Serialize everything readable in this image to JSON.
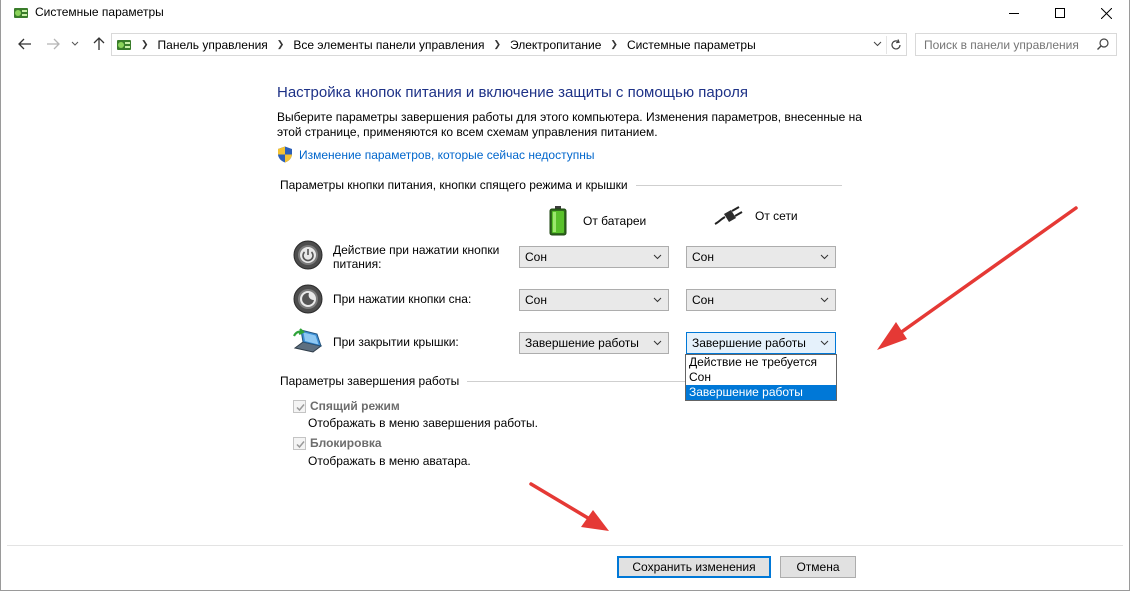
{
  "window": {
    "title": "Системные параметры"
  },
  "address_bar": {
    "breadcrumbs": [
      "Панель управления",
      "Все элементы панели управления",
      "Электропитание",
      "Системные параметры"
    ]
  },
  "search": {
    "placeholder": "Поиск в панели управления"
  },
  "page": {
    "title": "Настройка кнопок питания и включение защиты с помощью пароля",
    "description": "Выберите параметры завершения работы для этого компьютера. Изменения параметров, внесенные на этой странице, применяются ко всем схемам управления питанием.",
    "admin_link": "Изменение параметров, которые сейчас недоступны"
  },
  "power_group": {
    "header": "Параметры кнопки питания, кнопки спящего режима и крышки",
    "col_battery": "От батареи",
    "col_ac": "От сети",
    "rows": [
      {
        "label": "Действие при нажатии кнопки питания:",
        "battery": "Сон",
        "ac": "Сон"
      },
      {
        "label": "При нажатии кнопки сна:",
        "battery": "Сон",
        "ac": "Сон"
      },
      {
        "label": "При закрытии крышки:",
        "battery": "Завершение работы",
        "ac": "Завершение работы"
      }
    ],
    "dropdown_options": [
      "Действие не требуется",
      "Сон",
      "Завершение работы"
    ],
    "dropdown_selected_index": 2
  },
  "shutdown_group": {
    "header": "Параметры завершения работы",
    "items": [
      {
        "label": "Спящий режим",
        "sub": "Отображать в меню завершения работы.",
        "checked": true
      },
      {
        "label": "Блокировка",
        "sub": "Отображать в меню аватара.",
        "checked": true
      }
    ]
  },
  "buttons": {
    "save": "Сохранить изменения",
    "cancel": "Отмена"
  },
  "colors": {
    "title_blue": "#1e3287",
    "link_blue": "#0066cc",
    "select_focus": "#0078d7",
    "annotation_red": "#e53935"
  },
  "icons": [
    "control-panel-icon",
    "back-arrow-icon",
    "forward-arrow-icon",
    "up-arrow-icon",
    "refresh-icon",
    "search-icon",
    "uac-shield-icon",
    "battery-icon",
    "power-plug-icon",
    "power-button-icon",
    "sleep-button-icon",
    "laptop-lid-icon",
    "chevron-down-icon"
  ]
}
